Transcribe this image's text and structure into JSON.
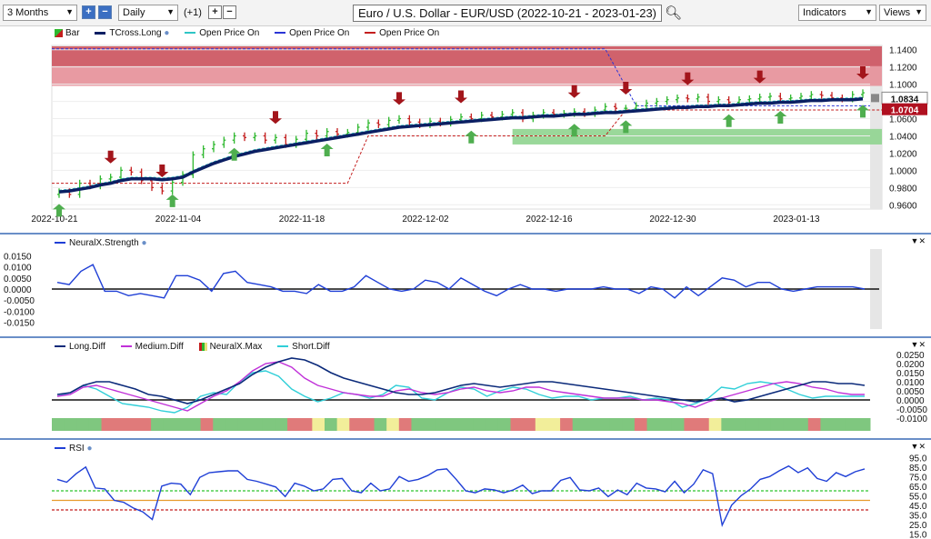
{
  "toolbar": {
    "period": "3 Months",
    "interval": "Daily",
    "offset": "(+1)",
    "title": "Euro / U.S. Dollar - EUR/USD (2022-10-21 - 2023-01-23)",
    "indicators": "Indicators",
    "views": "Views"
  },
  "colors": {
    "bull": "#2eb82e",
    "bear": "#c41e1e",
    "tcross": "#0b1f63",
    "cyan": "#2ec5c5",
    "blue_dash": "#2b35d6",
    "red_dash": "#c41e1e",
    "strength": "#1f3fd6",
    "long": "#0b2a7a",
    "medium": "#c030d8",
    "short": "#30cfd8",
    "rsi": "#1f3fd6",
    "green_level": "#2ec52e",
    "red_level": "#c41e1e",
    "orange_level": "#e89a2c"
  },
  "chart_data": [
    {
      "type": "line",
      "legend": [
        "Bar",
        "TCross.Long",
        "Open Price On",
        "Open Price On",
        "Open Price On"
      ],
      "x_ticks": [
        "2022-10-21",
        "2022-11-04",
        "2022-11-18",
        "2022-12-02",
        "2022-12-16",
        "2022-12-30",
        "2023-01-13"
      ],
      "y_ticks": [
        "1.1400",
        "1.1200",
        "1.1000",
        "1.0800",
        "1.0600",
        "1.0400",
        "1.0200",
        "1.0000",
        "0.9800",
        "0.9600"
      ],
      "ylim": [
        0.955,
        1.145
      ],
      "last_price": "1.0834",
      "tcross_price": "1.0704",
      "closes": [
        0.975,
        0.972,
        0.985,
        0.982,
        0.99,
        0.992,
        1.0,
        0.998,
        0.988,
        0.98,
        0.976,
        0.986,
        0.995,
        1.018,
        1.025,
        1.03,
        1.035,
        1.04,
        1.038,
        1.04,
        1.035,
        1.038,
        1.03,
        1.036,
        1.043,
        1.04,
        1.045,
        1.042,
        1.044,
        1.05,
        1.055,
        1.053,
        1.058,
        1.06,
        1.056,
        1.053,
        1.057,
        1.055,
        1.059,
        1.062,
        1.06,
        1.064,
        1.062,
        1.065,
        1.067,
        1.06,
        1.064,
        1.067,
        1.065,
        1.066,
        1.068,
        1.066,
        1.07,
        1.074,
        1.072,
        1.072,
        1.075,
        1.078,
        1.08,
        1.082,
        1.084,
        1.083,
        1.085,
        1.08,
        1.082,
        1.079,
        1.082,
        1.083,
        1.085,
        1.086,
        1.083,
        1.084,
        1.086,
        1.088,
        1.087,
        1.084,
        1.083,
        1.088,
        1.09
      ],
      "tcross": [
        0.975,
        0.976,
        0.978,
        0.98,
        0.983,
        0.985,
        0.988,
        0.99,
        0.99,
        0.99,
        0.989,
        0.99,
        0.992,
        0.998,
        1.003,
        1.008,
        1.012,
        1.016,
        1.019,
        1.022,
        1.024,
        1.026,
        1.028,
        1.03,
        1.032,
        1.034,
        1.036,
        1.038,
        1.04,
        1.042,
        1.044,
        1.046,
        1.048,
        1.05,
        1.051,
        1.052,
        1.053,
        1.054,
        1.055,
        1.056,
        1.057,
        1.058,
        1.059,
        1.06,
        1.061,
        1.061,
        1.062,
        1.063,
        1.063,
        1.064,
        1.065,
        1.065,
        1.066,
        1.067,
        1.067,
        1.068,
        1.069,
        1.07,
        1.071,
        1.072,
        1.073,
        1.073,
        1.074,
        1.074,
        1.075,
        1.075,
        1.076,
        1.077,
        1.078,
        1.078,
        1.079,
        1.079,
        1.08,
        1.081,
        1.081,
        1.082,
        1.082,
        1.082,
        1.083
      ],
      "red_zone": [
        1.098,
        1.144
      ],
      "green_zone": [
        1.03,
        1.048
      ],
      "down_arrows": [
        8,
        17,
        36,
        55,
        65,
        84,
        93,
        102,
        115,
        131
      ],
      "up_arrows": [
        0,
        19,
        29,
        44,
        67,
        84,
        93,
        110,
        117,
        131
      ]
    },
    {
      "type": "line",
      "series": [
        {
          "name": "NeuralX.Strength"
        }
      ],
      "y_ticks": [
        "0.0150",
        "0.0100",
        "0.0050",
        "0.0000",
        "-0.0050",
        "-0.0100",
        "-0.0150"
      ],
      "ylim": [
        -0.018,
        0.018
      ],
      "values": [
        0.003,
        0.002,
        0.008,
        0.011,
        -0.001,
        -0.001,
        -0.003,
        -0.002,
        -0.003,
        -0.004,
        0.006,
        0.006,
        0.004,
        -0.001,
        0.007,
        0.008,
        0.003,
        0.002,
        0.001,
        -0.001,
        -0.001,
        -0.002,
        0.002,
        -0.001,
        -0.001,
        0.001,
        0.006,
        0.003,
        0.0,
        -0.001,
        0.0,
        0.004,
        0.003,
        0.0,
        0.005,
        0.002,
        -0.001,
        -0.003,
        0.0,
        0.002,
        0.0,
        0.0,
        -0.001,
        0.0,
        0.0,
        0.0,
        0.001,
        0.0,
        0.0,
        -0.002,
        0.001,
        0.0,
        -0.004,
        0.001,
        -0.003,
        0.001,
        0.005,
        0.004,
        0.001,
        0.003,
        0.003,
        0.0,
        -0.001,
        0.0,
        0.001,
        0.001,
        0.001,
        0.001,
        0.0
      ]
    },
    {
      "type": "line",
      "series": [
        {
          "name": "Long.Diff"
        },
        {
          "name": "Medium.Diff"
        },
        {
          "name": "NeuralX.Max"
        },
        {
          "name": "Short.Diff"
        }
      ],
      "y_ticks": [
        "0.0250",
        "0.0200",
        "0.0150",
        "0.0100",
        "0.0050",
        "0.0000",
        "-0.0050",
        "-0.0100"
      ],
      "ylim": [
        -0.011,
        0.027
      ],
      "long": [
        0.003,
        0.004,
        0.008,
        0.01,
        0.01,
        0.008,
        0.006,
        0.003,
        0.002,
        0.0,
        -0.002,
        0.0,
        0.003,
        0.006,
        0.009,
        0.014,
        0.018,
        0.021,
        0.023,
        0.022,
        0.019,
        0.015,
        0.012,
        0.01,
        0.008,
        0.006,
        0.004,
        0.003,
        0.003,
        0.004,
        0.006,
        0.008,
        0.009,
        0.008,
        0.007,
        0.008,
        0.009,
        0.01,
        0.01,
        0.009,
        0.008,
        0.007,
        0.006,
        0.005,
        0.004,
        0.003,
        0.002,
        0.001,
        0.0,
        -0.001,
        0.0,
        0.001,
        -0.001,
        0.0,
        0.002,
        0.004,
        0.006,
        0.008,
        0.01,
        0.01,
        0.009,
        0.009,
        0.008
      ],
      "medium": [
        0.002,
        0.003,
        0.007,
        0.008,
        0.006,
        0.004,
        0.002,
        0.0,
        -0.002,
        -0.004,
        -0.006,
        -0.002,
        0.002,
        0.005,
        0.01,
        0.016,
        0.02,
        0.021,
        0.018,
        0.012,
        0.008,
        0.006,
        0.004,
        0.003,
        0.002,
        0.002,
        0.005,
        0.006,
        0.004,
        0.003,
        0.004,
        0.006,
        0.007,
        0.005,
        0.004,
        0.005,
        0.007,
        0.007,
        0.005,
        0.004,
        0.003,
        0.002,
        0.001,
        0.001,
        0.001,
        0.0,
        0.0,
        -0.001,
        -0.002,
        -0.004,
        -0.001,
        0.001,
        0.003,
        0.005,
        0.007,
        0.009,
        0.01,
        0.009,
        0.007,
        0.006,
        0.004,
        0.003,
        0.003
      ],
      "short": [
        0.002,
        0.004,
        0.008,
        0.006,
        0.002,
        -0.002,
        -0.003,
        -0.004,
        -0.006,
        -0.007,
        -0.004,
        0.002,
        0.004,
        0.003,
        0.01,
        0.015,
        0.016,
        0.013,
        0.006,
        0.002,
        -0.001,
        0.001,
        0.004,
        0.003,
        0.001,
        0.003,
        0.008,
        0.007,
        0.001,
        0.0,
        0.004,
        0.007,
        0.006,
        0.002,
        0.005,
        0.007,
        0.006,
        0.003,
        0.001,
        0.002,
        0.002,
        0.0,
        0.001,
        0.001,
        0.002,
        0.0,
        0.001,
        0.0,
        -0.004,
        -0.002,
        0.001,
        0.007,
        0.006,
        0.009,
        0.01,
        0.009,
        0.006,
        0.003,
        0.001,
        0.002,
        0.002,
        0.002,
        0.002
      ],
      "neuralx_max": [
        "g",
        "g",
        "g",
        "g",
        "r",
        "r",
        "r",
        "r",
        "g",
        "g",
        "g",
        "g",
        "r",
        "g",
        "g",
        "g",
        "g",
        "g",
        "g",
        "r",
        "r",
        "y",
        "g",
        "y",
        "r",
        "r",
        "g",
        "y",
        "r",
        "g",
        "g",
        "g",
        "g",
        "g",
        "g",
        "g",
        "g",
        "r",
        "r",
        "y",
        "y",
        "r",
        "g",
        "g",
        "g",
        "g",
        "g",
        "r",
        "g",
        "g",
        "g",
        "r",
        "r",
        "y",
        "g",
        "g",
        "g",
        "g",
        "g",
        "g",
        "g",
        "r",
        "g",
        "g",
        "g",
        "g"
      ]
    },
    {
      "type": "line",
      "series": [
        {
          "name": "RSI"
        }
      ],
      "y_ticks": [
        "95.0",
        "85.0",
        "75.0",
        "65.0",
        "55.0",
        "45.0",
        "35.0",
        "25.0",
        "15.0"
      ],
      "ylim": [
        20,
        100
      ],
      "levels": [
        {
          "value": 60,
          "color": "green"
        },
        {
          "value": 50,
          "color": "orange"
        },
        {
          "value": 40,
          "color": "red"
        }
      ],
      "values": [
        72,
        69,
        78,
        85,
        63,
        62,
        50,
        48,
        42,
        38,
        30,
        65,
        68,
        67,
        56,
        74,
        79,
        80,
        81,
        81,
        72,
        70,
        67,
        64,
        54,
        68,
        65,
        60,
        62,
        72,
        73,
        60,
        58,
        68,
        60,
        62,
        75,
        70,
        72,
        76,
        82,
        83,
        72,
        60,
        58,
        62,
        61,
        58,
        61,
        66,
        57,
        60,
        60,
        71,
        74,
        61,
        60,
        63,
        54,
        61,
        56,
        68,
        63,
        62,
        59,
        70,
        58,
        67,
        82,
        78,
        24,
        45,
        55,
        62,
        72,
        75,
        81,
        86,
        79,
        84,
        73,
        70,
        79,
        75,
        80,
        83
      ]
    }
  ],
  "panes": {
    "strength_label": "NeuralX.Strength",
    "rsi_label": "RSI"
  }
}
